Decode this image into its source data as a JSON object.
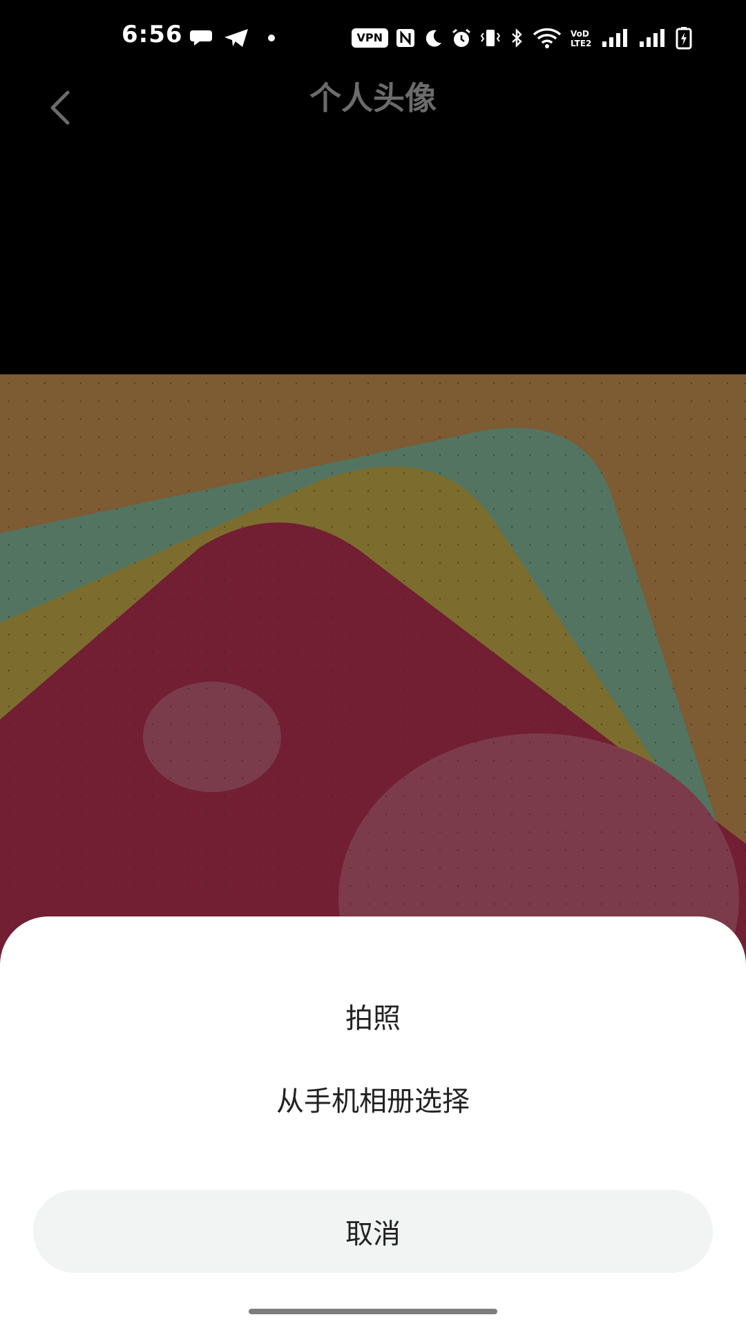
{
  "status_bar": {
    "time": "6:56",
    "vpn_label": "VPN",
    "icons": [
      "chat-bubble-icon",
      "telegram-icon",
      "dot-icon",
      "vpn-icon",
      "nfc-icon",
      "moon-icon",
      "alarm-icon",
      "vibrate-icon",
      "bluetooth-icon",
      "wifi-icon",
      "volte-icon",
      "signal-1-icon",
      "signal-2-icon",
      "battery-icon"
    ]
  },
  "header": {
    "title": "个人头像",
    "back_icon": "chevron-left-icon"
  },
  "sheet": {
    "take_photo": "拍照",
    "choose_from_album": "从手机相册选择",
    "cancel": "取消"
  },
  "colors": {
    "background": "#000000",
    "sheet_bg": "#ffffff",
    "cancel_bg": "#f2f3f3",
    "title_text": "#6b6b6b",
    "wallpaper_base": "#7d5b33",
    "wallpaper_green": "#537461",
    "wallpaper_olive": "#7c6d2e",
    "wallpaper_red": "#721e33",
    "wallpaper_pink": "#7c3b4a"
  }
}
